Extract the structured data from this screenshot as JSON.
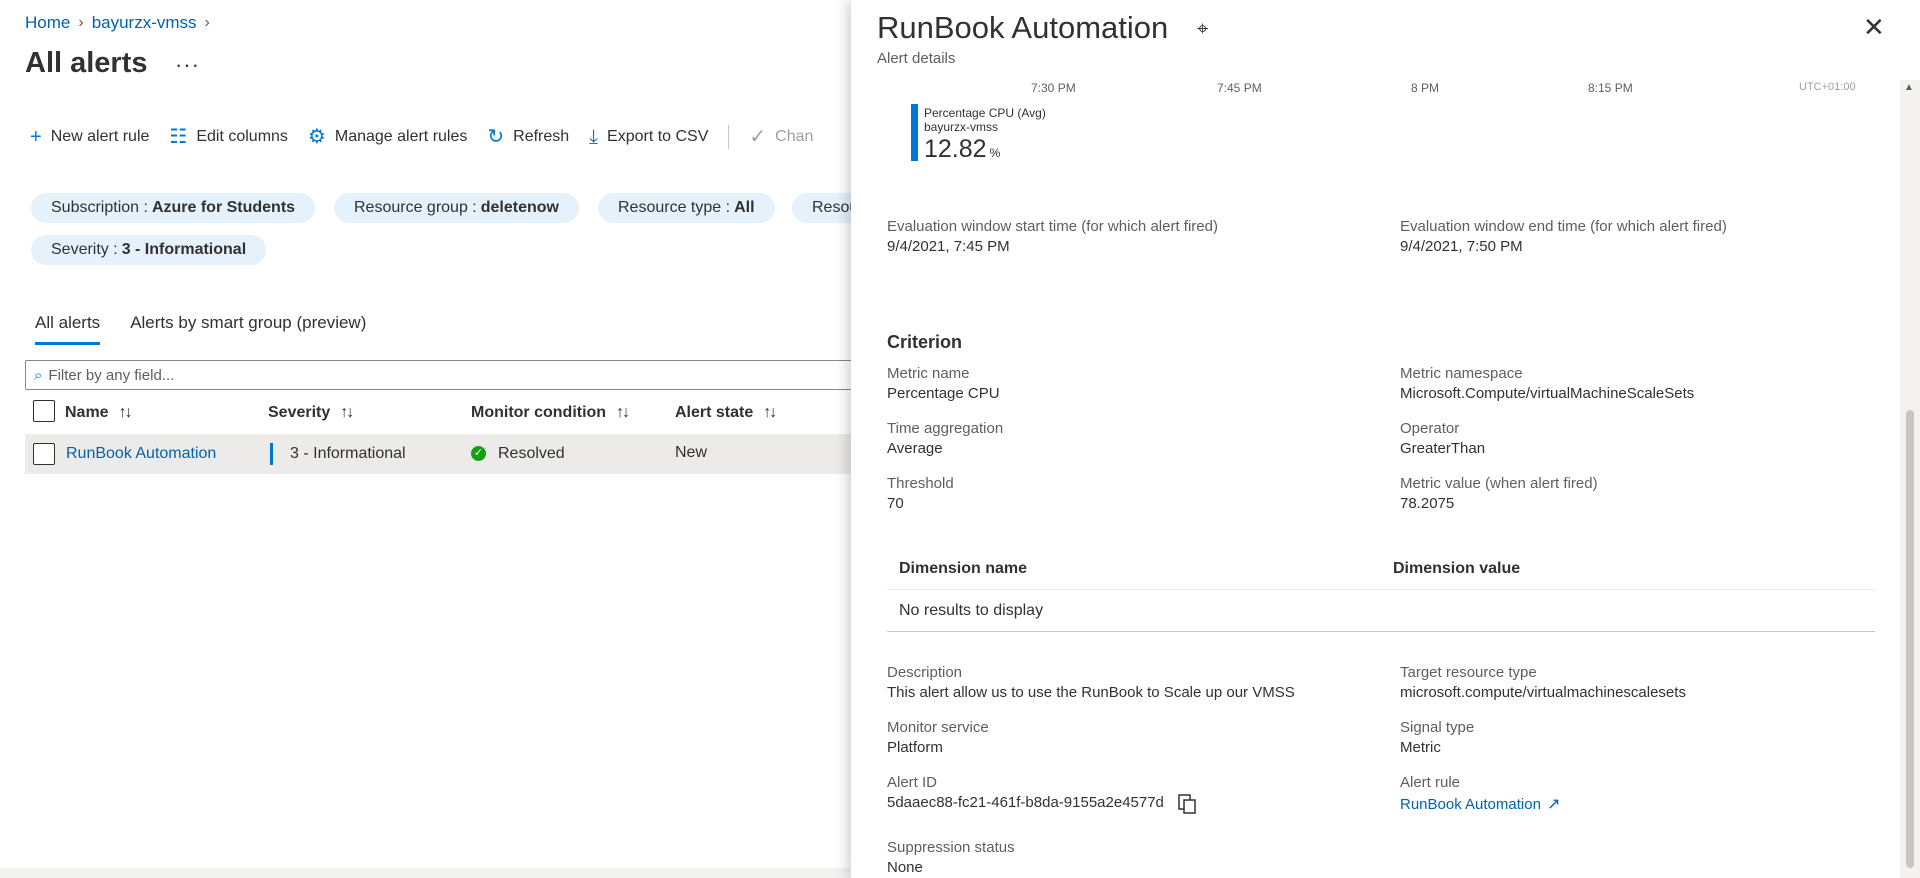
{
  "breadcrumb": {
    "home": "Home",
    "resource": "bayurzx-vmss"
  },
  "page": {
    "title": "All alerts",
    "more": "···"
  },
  "toolbar": {
    "new_alert_rule": "New alert rule",
    "edit_columns": "Edit columns",
    "manage_alert_rules": "Manage alert rules",
    "refresh": "Refresh",
    "export_csv": "Export to CSV",
    "change": "Chan"
  },
  "filters": {
    "subscription_label": "Subscription :",
    "subscription_value": "Azure for Students",
    "resource_group_label": "Resource group :",
    "resource_group_value": "deletenow",
    "resource_type_label": "Resource type :",
    "resource_type_value": "All",
    "resource_partial": "Resou",
    "severity_label": "Severity :",
    "severity_value": "3 - Informational"
  },
  "tabs": {
    "all_alerts": "All alerts",
    "smart_group": "Alerts by smart group (preview)"
  },
  "search": {
    "placeholder": "Filter by any field..."
  },
  "table": {
    "headers": {
      "name": "Name",
      "severity": "Severity",
      "monitor_condition": "Monitor condition",
      "alert_state": "Alert state"
    },
    "sort_icon": "↑↓",
    "rows": [
      {
        "name": "RunBook Automation",
        "severity": "3 - Informational",
        "monitor_condition": "Resolved",
        "alert_state": "New"
      }
    ]
  },
  "panel": {
    "title": "RunBook Automation",
    "subtitle": "Alert details",
    "chart": {
      "time_labels": [
        "7:30 PM",
        "7:45 PM",
        "8 PM",
        "8:15 PM"
      ],
      "timezone": "UTC+01:00",
      "metric_name": "Percentage CPU (Avg)",
      "resource": "bayurzx-vmss",
      "value": "12.82",
      "unit": "%"
    },
    "eval_start": {
      "label": "Evaluation window start time (for which alert fired)",
      "value": "9/4/2021, 7:45 PM"
    },
    "eval_end": {
      "label": "Evaluation window end time (for which alert fired)",
      "value": "9/4/2021, 7:50 PM"
    },
    "criterion": {
      "heading": "Criterion",
      "metric_name": {
        "label": "Metric name",
        "value": "Percentage CPU"
      },
      "metric_namespace": {
        "label": "Metric namespace",
        "value": "Microsoft.Compute/virtualMachineScaleSets"
      },
      "time_aggregation": {
        "label": "Time aggregation",
        "value": "Average"
      },
      "operator": {
        "label": "Operator",
        "value": "GreaterThan"
      },
      "threshold": {
        "label": "Threshold",
        "value": "70"
      },
      "metric_value": {
        "label": "Metric value (when alert fired)",
        "value": "78.2075"
      }
    },
    "dimensions": {
      "col_name": "Dimension name",
      "col_value": "Dimension value",
      "empty": "No results to display"
    },
    "description": {
      "label": "Description",
      "value": "This alert allow us to use the RunBook to Scale up our VMSS"
    },
    "target_resource_type": {
      "label": "Target resource type",
      "value": "microsoft.compute/virtualmachinescalesets"
    },
    "monitor_service": {
      "label": "Monitor service",
      "value": "Platform"
    },
    "signal_type": {
      "label": "Signal type",
      "value": "Metric"
    },
    "alert_id": {
      "label": "Alert ID",
      "value": "5daaec88-fc21-461f-b8da-9155a2e4577d"
    },
    "alert_rule": {
      "label": "Alert rule",
      "value": "RunBook Automation"
    },
    "suppression_status": {
      "label": "Suppression status",
      "value": "None"
    }
  },
  "colors": {
    "accent": "#0078d4",
    "link": "#0062ad",
    "pill_bg": "#e5f1fb",
    "row_selected": "#edebe9",
    "resolved": "#13a10e"
  }
}
